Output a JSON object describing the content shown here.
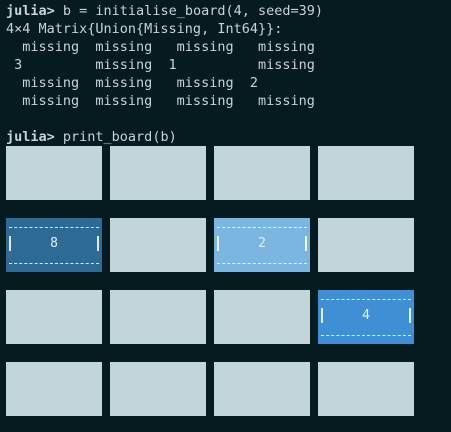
{
  "terminal": {
    "prompt": "julia>",
    "command1": " b = initialise_board(4, seed=39)",
    "output": [
      "4×4 Matrix{Union{Missing, Int64}}:",
      "  missing  missing   missing   missing",
      " 3         missing  1          missing",
      "  missing  missing   missing  2",
      "  missing  missing   missing   missing"
    ],
    "command2": " print_board(b)"
  },
  "board": {
    "size": 4,
    "tiles": [
      {
        "row": 1,
        "col": 0,
        "value": "8",
        "color": "#2d6a96"
      },
      {
        "row": 1,
        "col": 2,
        "value": "2",
        "color": "#7bb6e0"
      },
      {
        "row": 2,
        "col": 3,
        "value": "4",
        "color": "#3e8fd4"
      }
    ],
    "empty_color": "#c2d5d8"
  },
  "colors": {
    "background": "#061b1f",
    "text": "#c9d3d6"
  }
}
